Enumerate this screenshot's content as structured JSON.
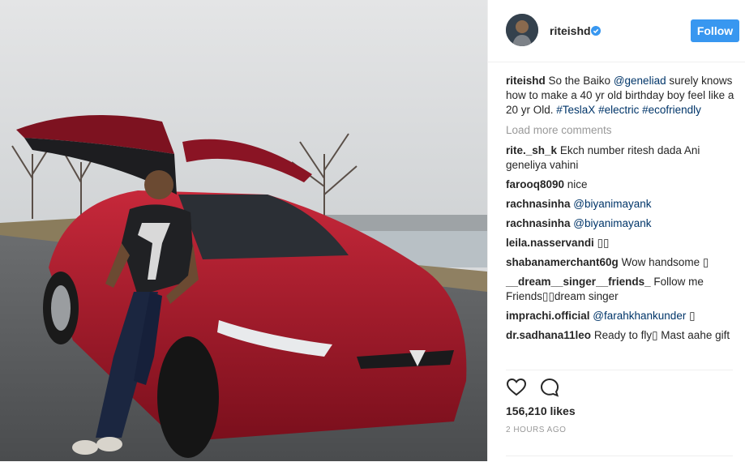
{
  "post": {
    "username": "riteishd",
    "follow_label": "Follow",
    "caption": {
      "username": "riteishd",
      "text_1": " So the Baiko ",
      "mention": "@geneliad",
      "text_2": " surely knows how to make a 40 yr old birthday boy feel like a 20 yr Old. ",
      "tags": [
        "#TeslaX",
        "#electric",
        "#ecofriendly"
      ]
    },
    "load_more_label": "Load more comments",
    "comments": [
      {
        "user": "rite._sh_k",
        "text": "Ekch number ritesh dada Ani geneliya vahini"
      },
      {
        "user": "farooq8090",
        "text": "nice"
      },
      {
        "user": "rachnasinha",
        "mention": "@biyanimayank",
        "text": ""
      },
      {
        "user": "rachnasinha",
        "mention": "@biyanimayank",
        "text": ""
      },
      {
        "user": "leila.nasservandi",
        "text": "▯▯"
      },
      {
        "user": "shabanamerchant60g",
        "text": "Wow handsome ▯"
      },
      {
        "user": "__dream__singer__friends_",
        "text": "Follow me Friends▯▯dream singer"
      },
      {
        "user": "imprachi.official",
        "mention": "@farahkhankunder",
        "text": "▯"
      },
      {
        "user": "dr.sadhana11leo",
        "text": "Ready to fly▯ Mast aahe gift"
      }
    ],
    "likes": "156,210 likes",
    "time": "2 HOURS AGO",
    "icons": [
      "heart-icon",
      "comment-icon",
      "verified-badge-icon"
    ],
    "colors": {
      "accent": "#3897f0",
      "link": "#003569",
      "muted": "#999999"
    }
  }
}
